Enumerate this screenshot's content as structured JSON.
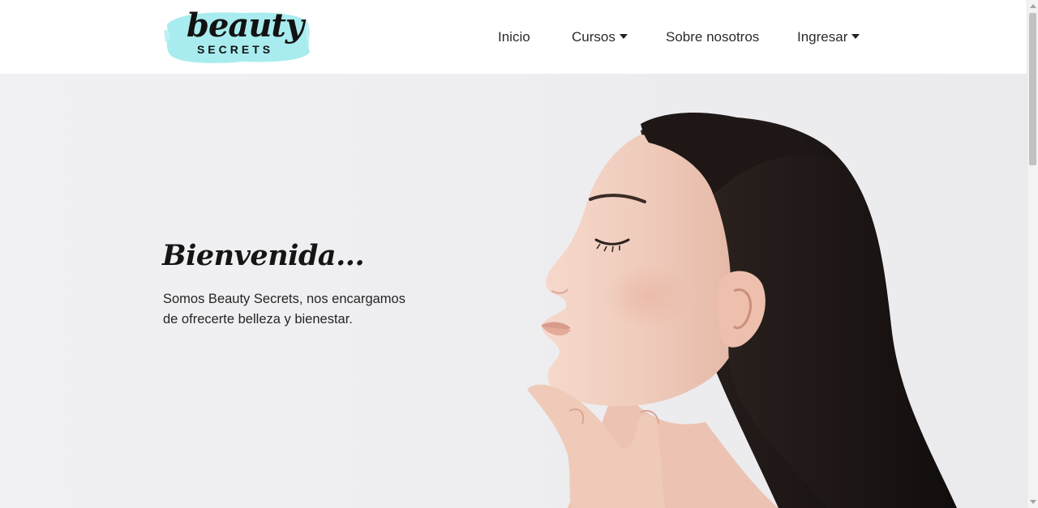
{
  "brand": {
    "logo_word": "beauty",
    "logo_sub": "SECRETS",
    "logo_accent_color": "#a9ecef"
  },
  "nav": {
    "items": [
      {
        "label": "Inicio",
        "has_dropdown": false
      },
      {
        "label": "Cursos",
        "has_dropdown": true
      },
      {
        "label": "Sobre nosotros",
        "has_dropdown": false
      },
      {
        "label": "Ingresar",
        "has_dropdown": true
      }
    ]
  },
  "hero": {
    "title": "Bienvenida...",
    "text": "Somos Beauty Secrets, nos encargamos de ofrecerte belleza y bienestar.",
    "image": "woman-profile-photo"
  }
}
